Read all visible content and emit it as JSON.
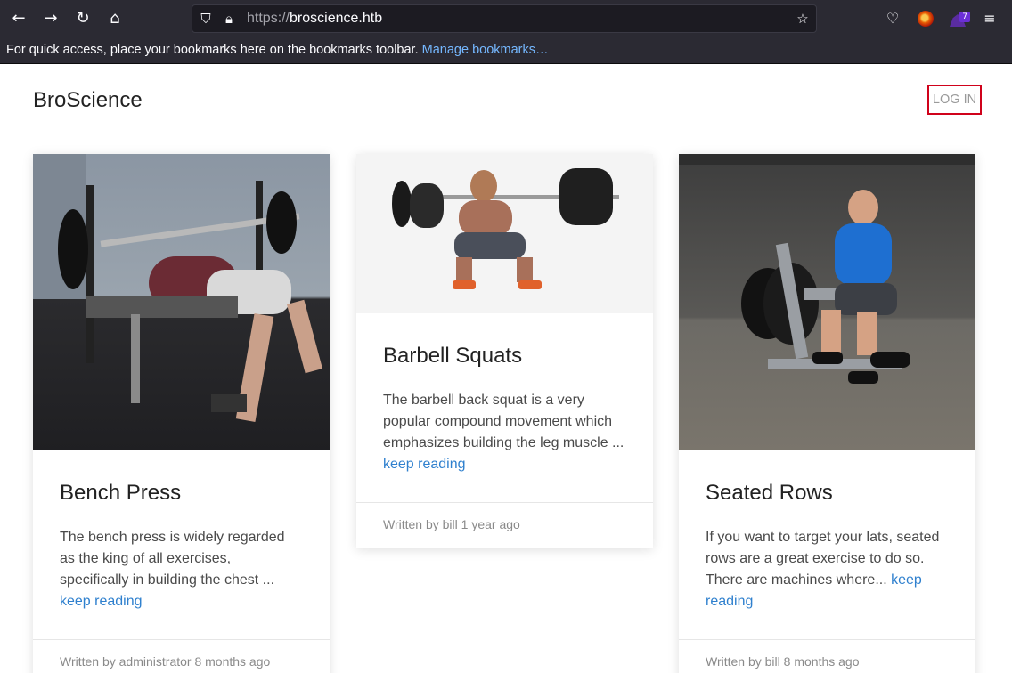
{
  "browser": {
    "url_scheme": "https://",
    "url_host": "broscience.htb",
    "bookmarks_message": "For quick access, place your bookmarks here on the bookmarks toolbar.",
    "manage_bookmarks": "Manage bookmarks…",
    "extension_badge": "7"
  },
  "site": {
    "brand": "BroScience",
    "login_label": "LOG IN",
    "login_highlight_color": "#d0021b",
    "link_color": "#2f80ce"
  },
  "posts": [
    {
      "title": "Bench Press",
      "excerpt": "The bench press is widely regarded as the king of all exercises, specifically in building the chest ...",
      "read_more": "keep reading",
      "meta": "Written by administrator 8 months ago"
    },
    {
      "title": "Barbell Squats",
      "excerpt": "The barbell back squat is a very popular compound movement which emphasizes building the leg muscle ...",
      "read_more": "keep reading",
      "meta": "Written by bill 1 year ago"
    },
    {
      "title": "Seated Rows",
      "excerpt": "If you want to target your lats, seated rows are a great exercise to do so. There are machines where...",
      "read_more": "keep reading",
      "meta": "Written by bill 8 months ago"
    }
  ]
}
